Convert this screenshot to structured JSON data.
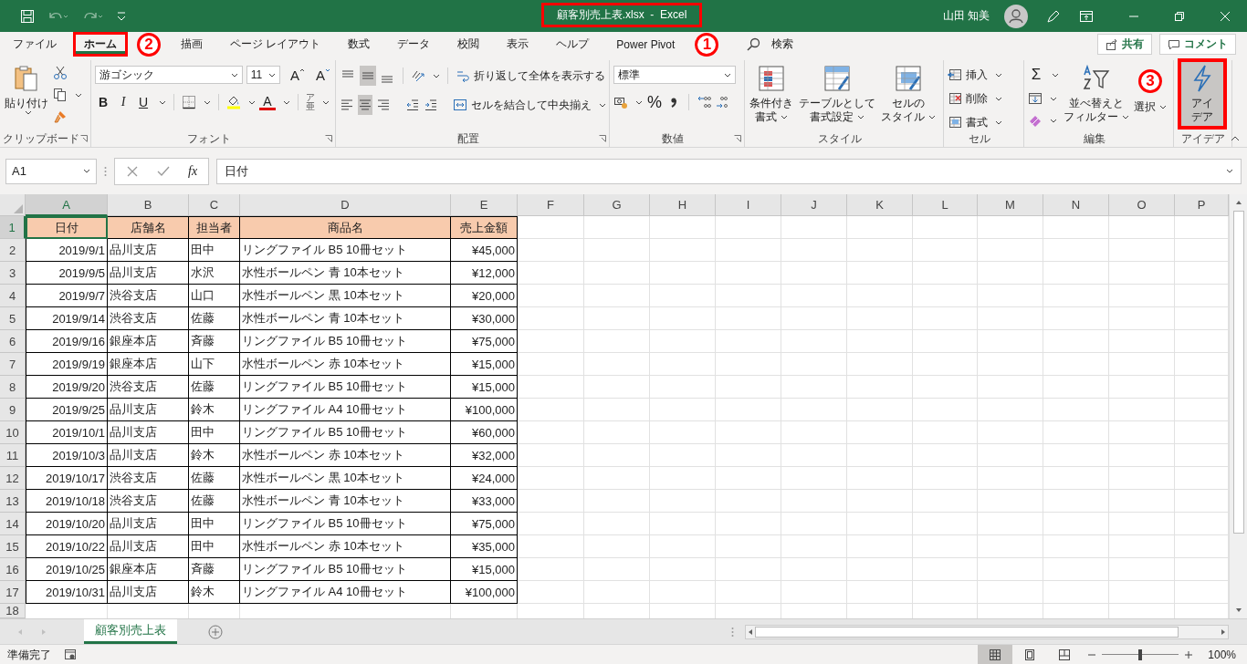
{
  "title_bar": {
    "title": "顧客別売上表.xlsx  -  Excel",
    "highlighted": true,
    "user": "山田 知美"
  },
  "tabs": [
    {
      "label": "ファイル",
      "selected": false,
      "highlighted": false
    },
    {
      "label": "ホーム",
      "selected": true,
      "highlighted": true
    },
    {
      "label": "描画",
      "selected": false,
      "highlighted": false
    },
    {
      "label": "ページ レイアウト",
      "selected": false,
      "highlighted": false
    },
    {
      "label": "数式",
      "selected": false,
      "highlighted": false
    },
    {
      "label": "データ",
      "selected": false,
      "highlighted": false
    },
    {
      "label": "校閲",
      "selected": false,
      "highlighted": false
    },
    {
      "label": "表示",
      "selected": false,
      "highlighted": false
    },
    {
      "label": "ヘルプ",
      "selected": false,
      "highlighted": false
    },
    {
      "label": "Power Pivot",
      "selected": false,
      "highlighted": false
    }
  ],
  "search": {
    "label": "検索"
  },
  "share_button": "共有",
  "comment_button": "コメント",
  "ribbon": {
    "clipboard": {
      "paste": "貼り付け",
      "group": "クリップボード"
    },
    "font": {
      "name": "游ゴシック",
      "size": "11",
      "grow": "A",
      "shrink": "A",
      "bold": "B",
      "italic": "I",
      "underline": "U",
      "font_color": "A",
      "phonetic_top": "ア",
      "phonetic_bottom": "亜",
      "group": "フォント"
    },
    "alignment": {
      "vertical": [
        {
          "selected": false
        },
        {
          "selected": true
        },
        {
          "selected": false
        }
      ],
      "horizontal": [
        {
          "selected": false
        },
        {
          "selected": true
        },
        {
          "selected": false
        }
      ],
      "wrap": "折り返して全体を表示する",
      "merge": "セルを結合して中央揃え",
      "group": "配置"
    },
    "number": {
      "format": "標準",
      "percent": "%",
      "group": "数値"
    },
    "styles": {
      "buttons": [
        {
          "line1": "条件付き",
          "line2": "書式"
        },
        {
          "line1": "テーブルとして",
          "line2": "書式設定"
        },
        {
          "line1": "セルの",
          "line2": "スタイル"
        }
      ],
      "group": "スタイル"
    },
    "cells": {
      "buttons": [
        "挿入",
        "削除",
        "書式"
      ],
      "group": "セル"
    },
    "editing": {
      "autosum": "Σ",
      "sort": {
        "line1": "並べ替えと",
        "line2": "フィルター"
      },
      "find": "選択",
      "group": "編集"
    },
    "ideas": {
      "line1": "アイ",
      "line2": "デア",
      "group": "アイデア",
      "highlighted": true
    }
  },
  "formula_bar": {
    "name_box": "A1",
    "fx": "fx",
    "content": "日付"
  },
  "columns": [
    {
      "label": "A",
      "selected": true
    },
    {
      "label": "B",
      "selected": false
    },
    {
      "label": "C",
      "selected": false
    },
    {
      "label": "D",
      "selected": false
    },
    {
      "label": "E",
      "selected": false
    },
    {
      "label": "F",
      "selected": false
    },
    {
      "label": "G",
      "selected": false
    },
    {
      "label": "H",
      "selected": false
    },
    {
      "label": "I",
      "selected": false
    },
    {
      "label": "J",
      "selected": false
    },
    {
      "label": "K",
      "selected": false
    },
    {
      "label": "L",
      "selected": false
    },
    {
      "label": "M",
      "selected": false
    },
    {
      "label": "N",
      "selected": false
    },
    {
      "label": "O",
      "selected": false
    },
    {
      "label": "P",
      "selected": false
    }
  ],
  "row_headers": [
    {
      "label": "1",
      "selected": true
    },
    {
      "label": "2",
      "selected": false
    },
    {
      "label": "3",
      "selected": false
    },
    {
      "label": "4",
      "selected": false
    },
    {
      "label": "5",
      "selected": false
    },
    {
      "label": "6",
      "selected": false
    },
    {
      "label": "7",
      "selected": false
    },
    {
      "label": "8",
      "selected": false
    },
    {
      "label": "9",
      "selected": false
    },
    {
      "label": "10",
      "selected": false
    },
    {
      "label": "11",
      "selected": false
    },
    {
      "label": "12",
      "selected": false
    },
    {
      "label": "13",
      "selected": false
    },
    {
      "label": "14",
      "selected": false
    },
    {
      "label": "15",
      "selected": false
    },
    {
      "label": "16",
      "selected": false
    },
    {
      "label": "17",
      "selected": false
    },
    {
      "label": "18",
      "selected": false
    }
  ],
  "table": {
    "header": [
      "日付",
      "店舗名",
      "担当者",
      "商品名",
      "売上金額"
    ],
    "rows": [
      [
        "2019/9/1",
        "品川支店",
        "田中",
        "リングファイル B5 10冊セット",
        "¥45,000"
      ],
      [
        "2019/9/5",
        "品川支店",
        "水沢",
        "水性ボールペン 青 10本セット",
        "¥12,000"
      ],
      [
        "2019/9/7",
        "渋谷支店",
        "山口",
        "水性ボールペン 黒 10本セット",
        "¥20,000"
      ],
      [
        "2019/9/14",
        "渋谷支店",
        "佐藤",
        "水性ボールペン 青 10本セット",
        "¥30,000"
      ],
      [
        "2019/9/16",
        "銀座本店",
        "斉藤",
        "リングファイル B5 10冊セット",
        "¥75,000"
      ],
      [
        "2019/9/19",
        "銀座本店",
        "山下",
        "水性ボールペン 赤 10本セット",
        "¥15,000"
      ],
      [
        "2019/9/20",
        "渋谷支店",
        "佐藤",
        "リングファイル B5 10冊セット",
        "¥15,000"
      ],
      [
        "2019/9/25",
        "品川支店",
        "鈴木",
        "リングファイル A4 10冊セット",
        "¥100,000"
      ],
      [
        "2019/10/1",
        "品川支店",
        "田中",
        "リングファイル B5 10冊セット",
        "¥60,000"
      ],
      [
        "2019/10/3",
        "品川支店",
        "鈴木",
        "水性ボールペン 赤 10本セット",
        "¥32,000"
      ],
      [
        "2019/10/17",
        "渋谷支店",
        "佐藤",
        "水性ボールペン 黒 10本セット",
        "¥24,000"
      ],
      [
        "2019/10/18",
        "渋谷支店",
        "佐藤",
        "水性ボールペン 青 10本セット",
        "¥33,000"
      ],
      [
        "2019/10/20",
        "品川支店",
        "田中",
        "リングファイル B5 10冊セット",
        "¥75,000"
      ],
      [
        "2019/10/22",
        "品川支店",
        "田中",
        "水性ボールペン 赤 10本セット",
        "¥35,000"
      ],
      [
        "2019/10/25",
        "銀座本店",
        "斉藤",
        "リングファイル B5 10冊セット",
        "¥15,000"
      ],
      [
        "2019/10/31",
        "品川支店",
        "鈴木",
        "リングファイル A4 10冊セット",
        "¥100,000"
      ]
    ]
  },
  "sheet_tabs": [
    {
      "label": "顧客別売上表",
      "selected": true
    }
  ],
  "status_bar": {
    "status": "準備完了",
    "zoom": "100%",
    "zoom_slider": {
      "level": 0.5
    }
  },
  "annotations": [
    {
      "label": "1"
    },
    {
      "label": "2"
    },
    {
      "label": "3"
    }
  ]
}
